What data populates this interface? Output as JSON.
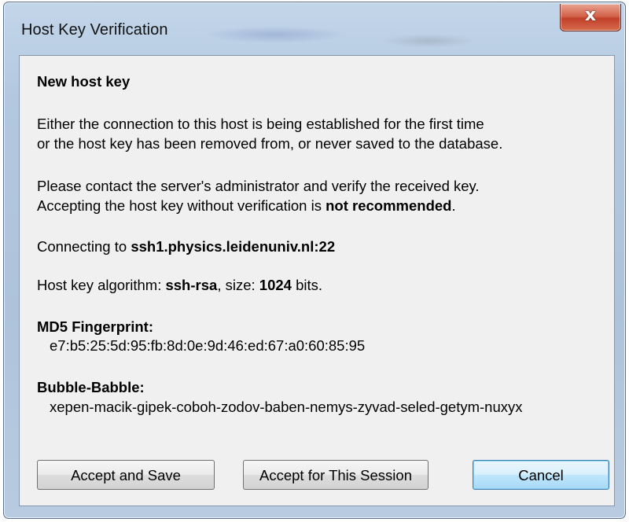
{
  "window": {
    "title": "Host Key Verification",
    "close_symbol": "x"
  },
  "dialog": {
    "heading": "New host key",
    "para1_line1": "Either the connection to this host is being established for the first time",
    "para1_line2": "or the host key has been removed from, or never saved to the database.",
    "para2_line1": "Please contact the server's administrator and verify the received key.",
    "para2_line2_prefix": "Accepting the host key without verification is ",
    "para2_line2_bold": "not recommended",
    "para2_line2_suffix": ".",
    "connecting_prefix": "Connecting to ",
    "host": "ssh1.physics.leidenuniv.nl",
    "port_sep": ":",
    "port": "22",
    "algo_prefix": "Host key algorithm: ",
    "algo": "ssh-rsa",
    "size_prefix": ", size: ",
    "size": "1024",
    "size_suffix": " bits.",
    "md5_label": "MD5 Fingerprint",
    "md5_colon": ":",
    "md5_value": "e7:b5:25:5d:95:fb:8d:0e:9d:46:ed:67:a0:60:85:95",
    "bb_label": "Bubble-Babble",
    "bb_colon": ":",
    "bb_value": "xepen-macik-gipek-coboh-zodov-baben-nemys-zyvad-seled-getym-nuxyx"
  },
  "buttons": {
    "accept_save": "Accept and Save",
    "accept_session": "Accept for This Session",
    "cancel": "Cancel"
  },
  "colors": {
    "title_bar": "#b3c8e0",
    "close_button": "#c2402a",
    "dialog_body": "#f0f0f0",
    "default_button_border": "#3c7fb1"
  }
}
